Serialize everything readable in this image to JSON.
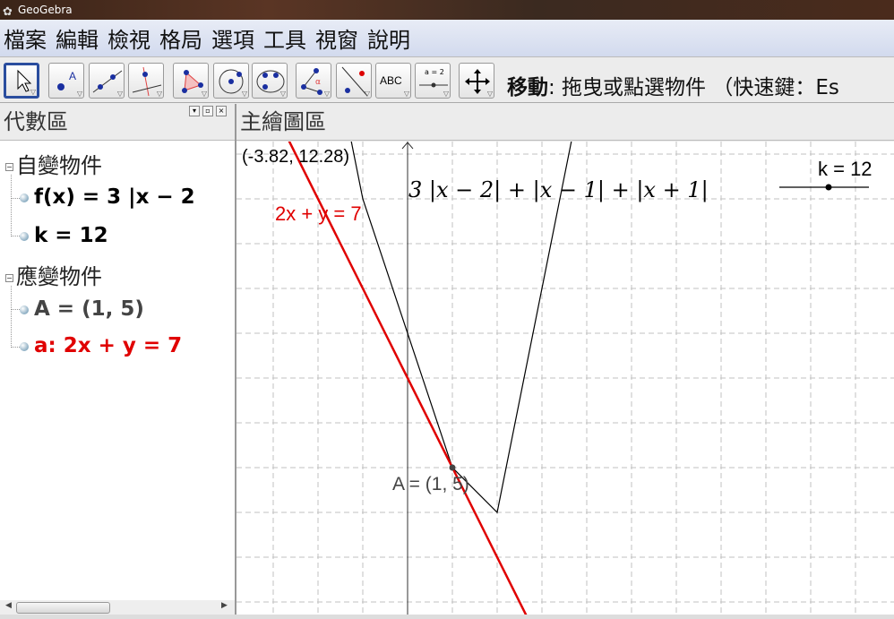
{
  "window": {
    "title": "GeoGebra"
  },
  "menu": [
    "檔案",
    "編輯",
    "檢視",
    "格局",
    "選項",
    "工具",
    "視窗",
    "說明"
  ],
  "toolbar": {
    "tools": [
      "move",
      "point",
      "line-through-two-points",
      "perpendicular-line",
      "polygon",
      "circle-center-point",
      "conic-five-points",
      "angle",
      "reflect-about-line",
      "text",
      "slider",
      "move-graphics-view"
    ],
    "text_label": "ABC",
    "slider_label": "a = 2",
    "status_bold": "移動",
    "status_rest": ": 拖曳或點選物件 （快速鍵：Es"
  },
  "algebra": {
    "title": "代數區",
    "free_label": "自變物件",
    "dependent_label": "應變物件",
    "free": [
      "f(x) = 3 |x − 2",
      "k = 12"
    ],
    "dependent": [
      "A = (1, 5)",
      "a: 2x + y = 7"
    ]
  },
  "graphics": {
    "title": "主繪圖區",
    "coord_readout": "(-3.82, 12.28)",
    "line_label": "2x + y = 7",
    "func_label": "3 |x − 2| + |x − 1| + |x + 1|",
    "point_label": "A = (1, 5)",
    "slider_label": "k = 12",
    "slider_value": 12,
    "colors": {
      "line": "#e00000",
      "func": "#000000",
      "grid": "#c0c0c0"
    }
  },
  "chart_data": {
    "type": "line",
    "function": "3|x-2|+|x-1|+|x+1|",
    "line": "2x+y=7",
    "point": [
      1,
      5
    ],
    "xlim": [
      -3.82,
      10.86
    ],
    "ylim": [
      -2.28,
      12.28
    ]
  }
}
